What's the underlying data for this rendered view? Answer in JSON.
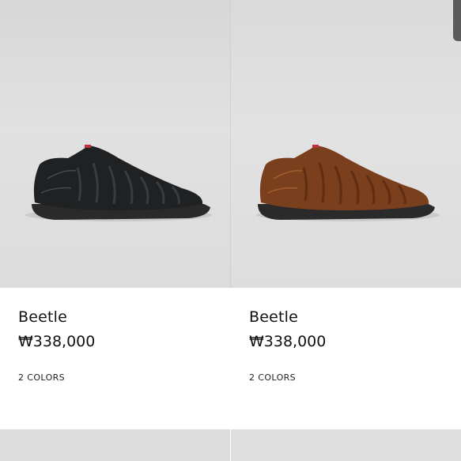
{
  "products": [
    {
      "name": "Beetle",
      "price": "₩338,000",
      "colors": "2 COLORS",
      "image": "black-leather-sneaker"
    },
    {
      "name": "Beetle",
      "price": "₩338,000",
      "colors": "2 COLORS",
      "image": "brown-leather-sneaker"
    }
  ],
  "palette": {
    "black_shoe": "#1f2123",
    "brown_shoe": "#7a3f1c",
    "sole": "#2b2a2a",
    "accent": "#c0303a"
  }
}
